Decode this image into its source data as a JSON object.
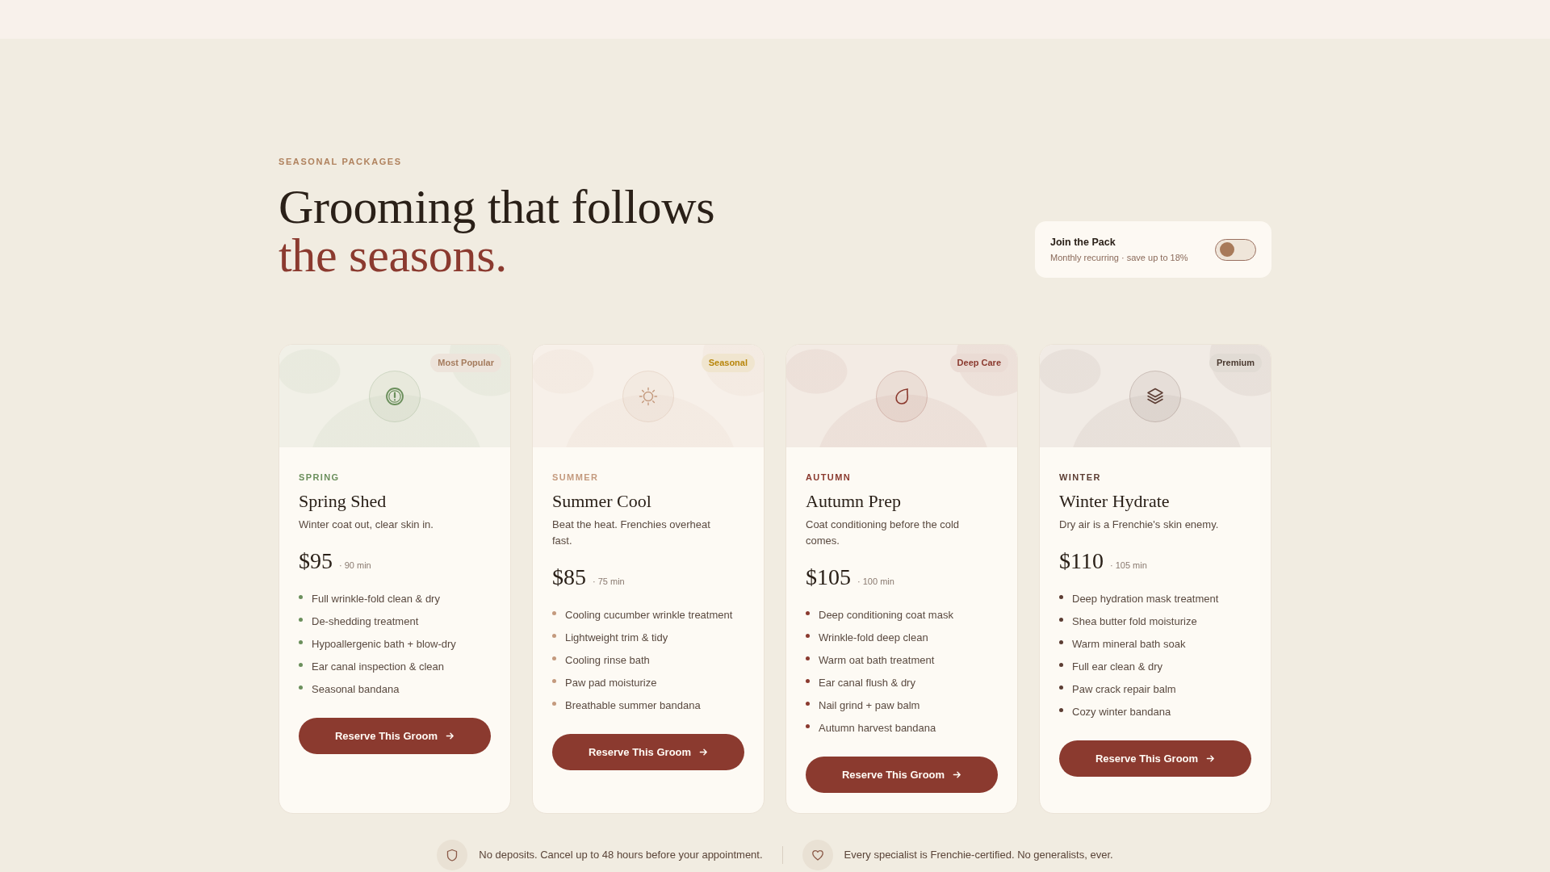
{
  "header": {
    "eyebrow": "SEASONAL PACKAGES",
    "title": "Grooming that follows",
    "title_accent": "the seasons."
  },
  "membership": {
    "title": "Join the Pack",
    "subtitle": "Monthly recurring · save up to 18%",
    "on": false
  },
  "packages": [
    {
      "season": "SPRING",
      "color": "#6b8f5c",
      "badge": {
        "label": "Most Popular",
        "color": "#a57c5e"
      },
      "name": "Spring Shed",
      "description": "Winter coat out, clear skin in.",
      "price": "$95",
      "duration": "· 90 min",
      "features": [
        "Full wrinkle-fold clean & dry",
        "De-shedding treatment",
        "Hypoallergenic bath + blow-dry",
        "Ear canal inspection & clean",
        "Seasonal bandana"
      ],
      "button": "Reserve This Groom"
    },
    {
      "season": "SUMMER",
      "color": "#c49a7e",
      "badge": {
        "label": "Seasonal",
        "color": "#b8860b"
      },
      "name": "Summer Cool",
      "description": "Beat the heat. Frenchies overheat fast.",
      "price": "$85",
      "duration": "· 75 min",
      "features": [
        "Cooling cucumber wrinkle treatment",
        "Lightweight trim & tidy",
        "Cooling rinse bath",
        "Paw pad moisturize",
        "Breathable summer bandana"
      ],
      "button": "Reserve This Groom"
    },
    {
      "season": "AUTUMN",
      "color": "#8b3a2f",
      "badge": {
        "label": "Deep Care",
        "color": "#8b3a2f"
      },
      "name": "Autumn Prep",
      "description": "Coat conditioning before the cold comes.",
      "price": "$105",
      "duration": "· 100 min",
      "features": [
        "Deep conditioning coat mask",
        "Wrinkle-fold deep clean",
        "Warm oat bath treatment",
        "Ear canal flush & dry",
        "Nail grind + paw balm",
        "Autumn harvest bandana"
      ],
      "button": "Reserve This Groom"
    },
    {
      "season": "WINTER",
      "color": "#5c3d33",
      "badge": {
        "label": "Premium",
        "color": "#4a3a30"
      },
      "name": "Winter Hydrate",
      "description": "Dry air is a Frenchie's skin enemy.",
      "price": "$110",
      "duration": "· 105 min",
      "features": [
        "Deep hydration mask treatment",
        "Shea butter fold moisturize",
        "Warm mineral bath soak",
        "Full ear clean & dry",
        "Paw crack repair balm",
        "Cozy winter bandana"
      ],
      "button": "Reserve This Groom"
    }
  ],
  "notes": [
    {
      "text": "No deposits. Cancel up to 48 hours before your appointment."
    },
    {
      "text": "Every specialist is Frenchie-certified. No generalists, ever."
    }
  ]
}
